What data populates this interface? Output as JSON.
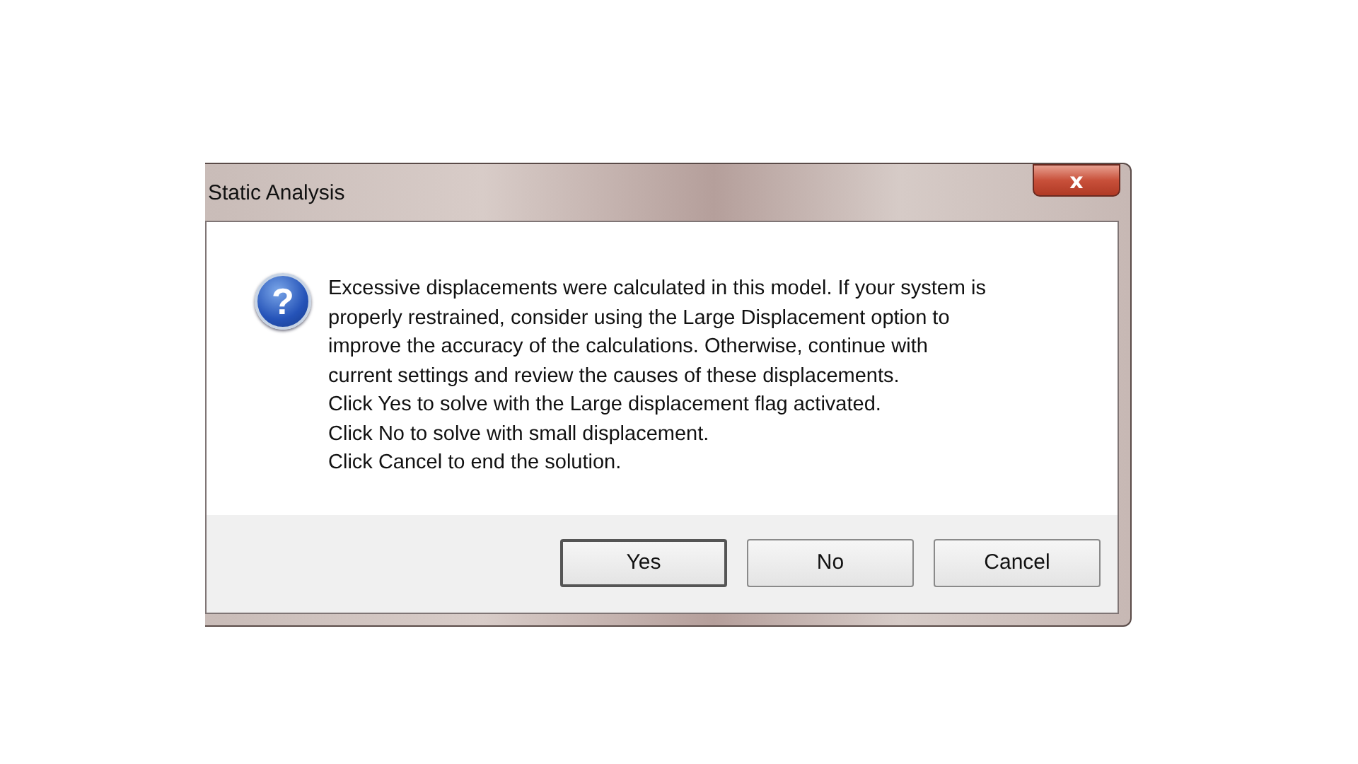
{
  "window": {
    "title": "Static Analysis",
    "close_label": "x"
  },
  "icon": "?",
  "message_lines": [
    "Excessive displacements were calculated in this model. If your system is",
    "properly restrained, consider using the Large Displacement option to",
    "improve the accuracy of the calculations.  Otherwise, continue with",
    "current settings and review the causes of these displacements.",
    "Click Yes to solve with the Large displacement flag activated.",
    "Click No to solve with small displacement.",
    "Click Cancel to end the solution."
  ],
  "buttons": [
    {
      "label": "Yes",
      "default": true
    },
    {
      "label": "No",
      "default": false
    },
    {
      "label": "Cancel",
      "default": false
    }
  ]
}
